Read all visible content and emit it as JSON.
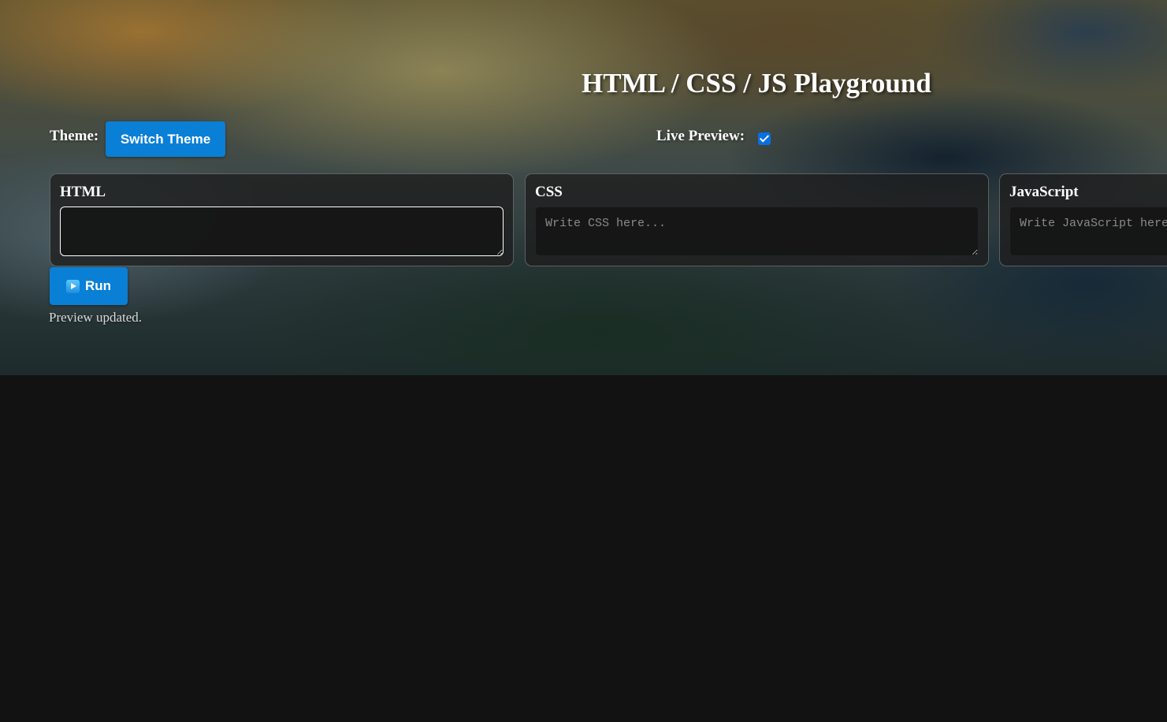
{
  "header": {
    "title": "HTML / CSS / JS Playground"
  },
  "controls": {
    "theme_label": "Theme:",
    "switch_theme_label": "Switch Theme",
    "live_preview_label": "Live Preview:",
    "live_preview_checked": true
  },
  "editors": [
    {
      "label": "HTML",
      "value": "",
      "placeholder": ""
    },
    {
      "label": "CSS",
      "value": "",
      "placeholder": "Write CSS here..."
    },
    {
      "label": "JavaScript",
      "value": "",
      "placeholder": "Write JavaScript here..."
    }
  ],
  "run_button": {
    "icon": "play-icon",
    "label": "Run"
  },
  "status": {
    "text": "Preview updated."
  },
  "colors": {
    "accent": "#0a7fd6",
    "page_background": "#121212"
  }
}
